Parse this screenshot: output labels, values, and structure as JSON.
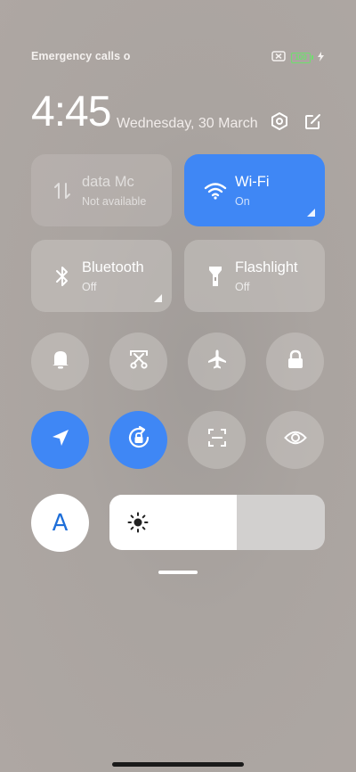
{
  "status_bar": {
    "carrier_text": "Emergency calls o",
    "battery_level": "100",
    "icons": [
      "no-sim-icon",
      "battery-icon",
      "charging-bolt-icon"
    ]
  },
  "header": {
    "time": "4:45",
    "date": "Wednesday, 30 March",
    "icons": [
      "settings-icon",
      "edit-icon"
    ]
  },
  "tiles": {
    "mobile_data": {
      "label": "data    Mc",
      "sub": "Not available",
      "icon": "mobile-data-icon",
      "state": "disabled"
    },
    "wifi": {
      "label": "Wi-Fi",
      "sub": "On",
      "icon": "wifi-icon",
      "state": "on"
    },
    "bluetooth": {
      "label": "Bluetooth",
      "sub": "Off",
      "icon": "bluetooth-icon",
      "state": "off"
    },
    "flashlight": {
      "label": "Flashlight",
      "sub": "Off",
      "icon": "flashlight-icon",
      "state": "off"
    }
  },
  "toggles_row1": [
    {
      "name": "ringer-toggle",
      "icon": "bell-icon",
      "state": "off"
    },
    {
      "name": "screenshot-toggle",
      "icon": "scissors-screenshot-icon",
      "state": "off"
    },
    {
      "name": "airplane-mode-toggle",
      "icon": "airplane-icon",
      "state": "off"
    },
    {
      "name": "lock-screen-toggle",
      "icon": "lock-icon",
      "state": "off"
    }
  ],
  "toggles_row2": [
    {
      "name": "location-toggle",
      "icon": "location-arrow-icon",
      "state": "on"
    },
    {
      "name": "rotation-lock-toggle",
      "icon": "rotation-lock-icon",
      "state": "on"
    },
    {
      "name": "scanner-toggle",
      "icon": "scan-frame-icon",
      "state": "off"
    },
    {
      "name": "reading-mode-toggle",
      "icon": "eye-icon",
      "state": "off"
    }
  ],
  "brightness": {
    "auto_label": "A",
    "level_fraction": 0.59,
    "icon": "sun-icon"
  },
  "colors": {
    "accent_blue": "#3f87f5",
    "battery_green": "#6ee06e",
    "tile_off": "#c8c4c1"
  }
}
